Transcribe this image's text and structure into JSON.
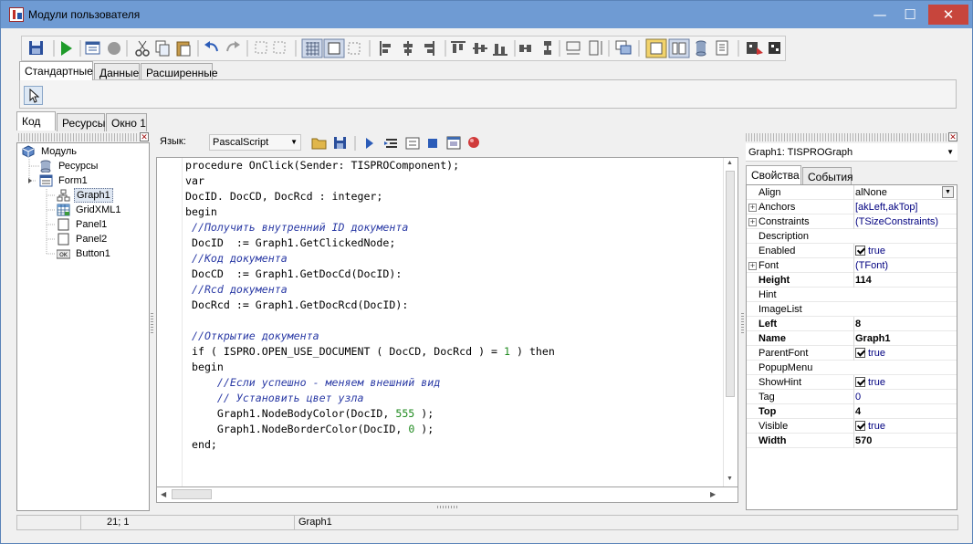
{
  "window": {
    "title": "Модули пользователя",
    "minimize": "—",
    "maximize": "☐",
    "close": "✕"
  },
  "palette_tabs": [
    "Стандартные",
    "Данные",
    "Расширенные"
  ],
  "bottom_tabs": [
    "Код",
    "Ресурсы",
    "Окно 1"
  ],
  "tree": {
    "root": "Модуль",
    "items": [
      "Ресурсы",
      "Form1",
      "Graph1",
      "GridXML1",
      "Panel1",
      "Panel2",
      "Button1"
    ]
  },
  "editor": {
    "language_label": "Язык:",
    "language_value": "PascalScript",
    "lines": [
      [
        [
          "kw",
          "procedure OnClick(Sender: TISPROComponent);"
        ]
      ],
      [
        [
          "kw",
          "var"
        ]
      ],
      [
        [
          "kw",
          "DocID. DocCD, DocRcd : integer;"
        ]
      ],
      [
        [
          "kw",
          "begin"
        ]
      ],
      [
        [
          "cm",
          " //Получить внутренний ID документа"
        ]
      ],
      [
        [
          "kw",
          " DocID  := Graph1.GetClickedNode;"
        ]
      ],
      [
        [
          "cm",
          " //Код документа"
        ]
      ],
      [
        [
          "kw",
          " DocCD  := Graph1.GetDocCd(DocID):"
        ]
      ],
      [
        [
          "cm",
          " //Rcd документа"
        ]
      ],
      [
        [
          "kw",
          " DocRcd := Graph1.GetDocRcd(DocID):"
        ]
      ],
      [
        [
          "kw",
          ""
        ]
      ],
      [
        [
          "cm",
          " //Открытие документа"
        ]
      ],
      [
        [
          "kw",
          " if ( ISPRO.OPEN_USE_DOCUMENT ( DocCD, DocRcd ) = "
        ],
        [
          "num",
          "1"
        ],
        [
          "kw",
          " ) then"
        ]
      ],
      [
        [
          "kw",
          " begin"
        ]
      ],
      [
        [
          "cm",
          "     //Если успешно - меняем внешний вид"
        ]
      ],
      [
        [
          "cm",
          "     // Установить цвет узла"
        ]
      ],
      [
        [
          "kw",
          "     Graph1.NodeBodyColor(DocID, "
        ],
        [
          "num",
          "555"
        ],
        [
          "kw",
          " );"
        ]
      ],
      [
        [
          "kw",
          "     Graph1.NodeBorderColor(DocID, "
        ],
        [
          "num",
          "0"
        ],
        [
          "kw",
          " );"
        ]
      ],
      [
        [
          "kw",
          " end;"
        ]
      ]
    ]
  },
  "inspector": {
    "component": "Graph1: TISPROGraph",
    "tabs": [
      "Свойства",
      "События"
    ],
    "properties": [
      {
        "name": "Align",
        "value": "alNone",
        "dropdown": true
      },
      {
        "name": "Anchors",
        "value": "[akLeft,akTop]",
        "expand": true
      },
      {
        "name": "Constraints",
        "value": "(TSizeConstraints)",
        "expand": true
      },
      {
        "name": "Description",
        "value": ""
      },
      {
        "name": "Enabled",
        "value": "true",
        "check": true
      },
      {
        "name": "Font",
        "value": "(TFont)",
        "expand": true
      },
      {
        "name": "Height",
        "value": "114",
        "bold": true
      },
      {
        "name": "Hint",
        "value": ""
      },
      {
        "name": "ImageList",
        "value": ""
      },
      {
        "name": "Left",
        "value": "8",
        "bold": true
      },
      {
        "name": "Name",
        "value": "Graph1",
        "bold": true
      },
      {
        "name": "ParentFont",
        "value": "true",
        "check": true
      },
      {
        "name": "PopupMenu",
        "value": ""
      },
      {
        "name": "ShowHint",
        "value": "true",
        "check": true
      },
      {
        "name": "Tag",
        "value": "0"
      },
      {
        "name": "Top",
        "value": "4",
        "bold": true
      },
      {
        "name": "Visible",
        "value": "true",
        "check": true
      },
      {
        "name": "Width",
        "value": "570",
        "bold": true
      }
    ]
  },
  "status": {
    "position": "21; 1",
    "component": "Graph1"
  },
  "icons": [
    "save-icon",
    "run-icon",
    "stop-icon",
    "cut-icon",
    "copy-icon",
    "paste-icon",
    "undo-icon",
    "redo-icon",
    "grid-icon",
    "align-icon",
    "open-icon",
    "breakpoint-icon"
  ]
}
